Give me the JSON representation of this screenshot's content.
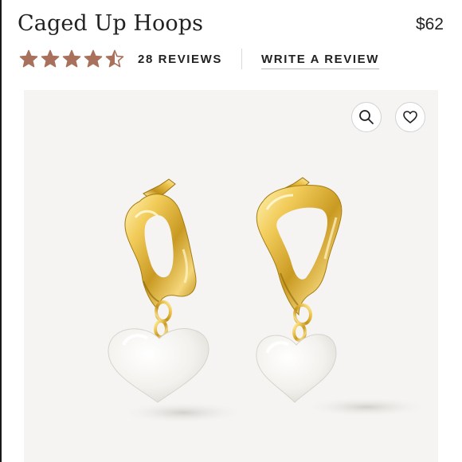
{
  "product": {
    "title": "Caged Up Hoops",
    "price": "$62"
  },
  "rating": {
    "stars": 4.5,
    "max_stars": 5,
    "star_color": "#a9705c",
    "reviews_label": "28 REVIEWS",
    "write_review_label": "WRITE A REVIEW"
  },
  "image": {
    "subject": "gold hoop earrings with white heart charms",
    "background_color": "#f5f4f2"
  },
  "actions": {
    "zoom_icon": "search-icon",
    "favorite_icon": "heart-outline-icon"
  }
}
